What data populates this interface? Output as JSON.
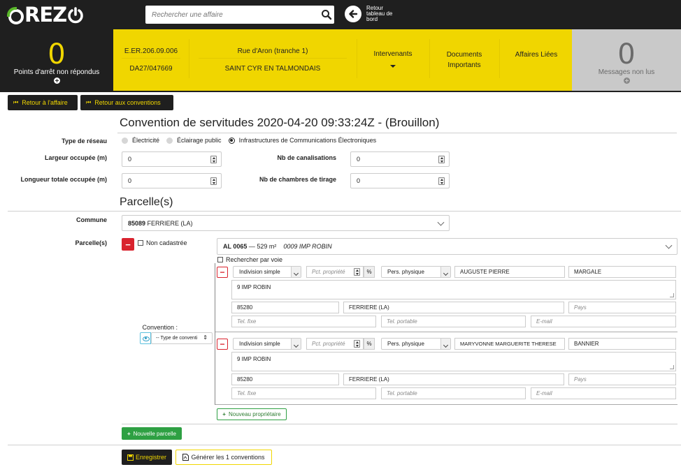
{
  "app": {
    "logo_text": "REZ",
    "search_placeholder": "Rechercher une affaire",
    "back_to_dashboard": "Retour tableau de bord"
  },
  "header": {
    "points_arret_count": "0",
    "points_arret_label": "Points d'arrêt non répondus",
    "code1": "E.ER.206.09.006",
    "code2": "DA27/047669",
    "street": "Rue d'Aron (tranche 1)",
    "city": "SAINT CYR EN TALMONDAIS",
    "intervenants": "Intervenants",
    "documents": "Documents Importants",
    "affaires": "Affaires Liées",
    "messages_count": "0",
    "messages_label": "Messages non lus"
  },
  "nav": {
    "retour_affaire": "Retour à l'affaire",
    "retour_conventions": "Retour aux conventions"
  },
  "form": {
    "title": "Convention de servitudes 2020-04-20 09:33:24Z - (Brouillon)",
    "type_reseau_label": "Type de réseau",
    "reseau_options": [
      "Électricité",
      "Éclairage public",
      "Infrastructures de Communications Électroniques"
    ],
    "largeur_label": "Largeur occupée (m)",
    "largeur_value": "0",
    "longueur_label": "Longueur totale occupée (m)",
    "longueur_value": "0",
    "canalisations_label": "Nb de canalisations",
    "canalisations_value": "0",
    "chambres_label": "Nb de chambres de tirage",
    "chambres_value": "0",
    "parcelles_title": "Parcelle(s)",
    "commune_label": "Commune",
    "commune_code": "85089",
    "commune_name": "FERRIERE (LA)",
    "parcelles_label": "Parcelle(s)",
    "non_cadastree": "Non cadastrée",
    "parcel_ref": "AL 0065",
    "parcel_area": "— 529 m²",
    "parcel_address": "0009 IMP ROBIN",
    "rechercher_voie": "Rechercher par voie",
    "convention_label": "Convention :",
    "convention_type_placeholder": "-- Type de conventi"
  },
  "owners": [
    {
      "indivision": "Indivision simple",
      "pct_placeholder": "Pct. propriété",
      "pct_symbol": "%",
      "person_type": "Pers. physique",
      "first_name": "AUGUSTE PIERRE",
      "last_name": "MARGALE",
      "address": "9 IMP ROBIN",
      "postal_code": "85280",
      "city": "FERRIERE (LA)",
      "country_placeholder": "Pays",
      "tel_fixe_placeholder": "Tel. fixe",
      "tel_portable_placeholder": "Tel. portable",
      "email_placeholder": "E-mail"
    },
    {
      "indivision": "Indivision simple",
      "pct_placeholder": "Pct. propriété",
      "pct_symbol": "%",
      "person_type": "Pers. physique",
      "first_name": "MARYVONNE MARGUERITE THERESE",
      "last_name": "BANNIER",
      "address": "9 IMP ROBIN",
      "postal_code": "85280",
      "city": "FERRIERE (LA)",
      "country_placeholder": "Pays",
      "tel_fixe_placeholder": "Tel. fixe",
      "tel_portable_placeholder": "Tel. portable",
      "email_placeholder": "E-mail"
    }
  ],
  "actions": {
    "nouveau_proprietaire": "Nouveau propriétaire",
    "nouvelle_parcelle": "Nouvelle parcelle",
    "enregistrer": "Enregistrer",
    "generer": "Générer les 1 conventions"
  },
  "colors": {
    "brand_yellow": "#f0d600",
    "dark": "#1f1f1f",
    "logo_green": "#5ab72a",
    "danger": "#d9232e",
    "success": "#2ea043"
  }
}
